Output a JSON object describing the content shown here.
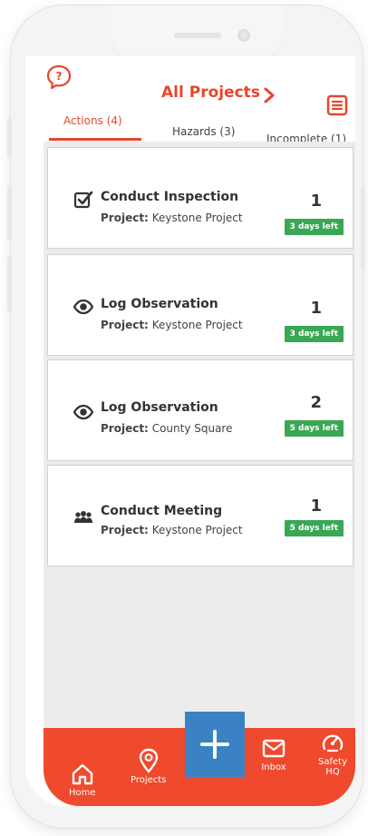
{
  "header": {
    "title": "All Projects",
    "help_icon": "help-icon",
    "menu_icon": "menu-icon"
  },
  "tabs": [
    {
      "label": "Actions (4)",
      "active": true
    },
    {
      "label": "Hazards (3)",
      "active": false
    },
    {
      "label": "Incomplete (1)",
      "active": false
    }
  ],
  "items": [
    {
      "icon": "checkbox-icon",
      "title": "Conduct Inspection",
      "project_label": "Project:",
      "project": "Keystone Project",
      "count": "1",
      "badge": "3 days left"
    },
    {
      "icon": "eye-icon",
      "title": "Log Observation",
      "project_label": "Project:",
      "project": "Keystone Project",
      "count": "1",
      "badge": "3 days left"
    },
    {
      "icon": "eye-icon",
      "title": "Log Observation",
      "project_label": "Project:",
      "project": "County Square",
      "count": "2",
      "badge": "5 days left"
    },
    {
      "icon": "people-icon",
      "title": "Conduct Meeting",
      "project_label": "Project:",
      "project": "Keystone Project",
      "count": "1",
      "badge": "5 days left"
    }
  ],
  "bottom_nav": [
    {
      "label": "Home",
      "icon": "home-icon"
    },
    {
      "label": "Projects",
      "icon": "location-pin-icon"
    },
    {
      "label": "Inbox",
      "icon": "envelope-icon"
    },
    {
      "label": "Safety HQ",
      "icon": "speedometer-icon"
    }
  ],
  "colors": {
    "accent": "#e8452c",
    "nav_bg": "#ef4a2d",
    "badge_green": "#3aa755",
    "add_button_blue": "#3a82c4",
    "list_bg": "#ececec"
  }
}
